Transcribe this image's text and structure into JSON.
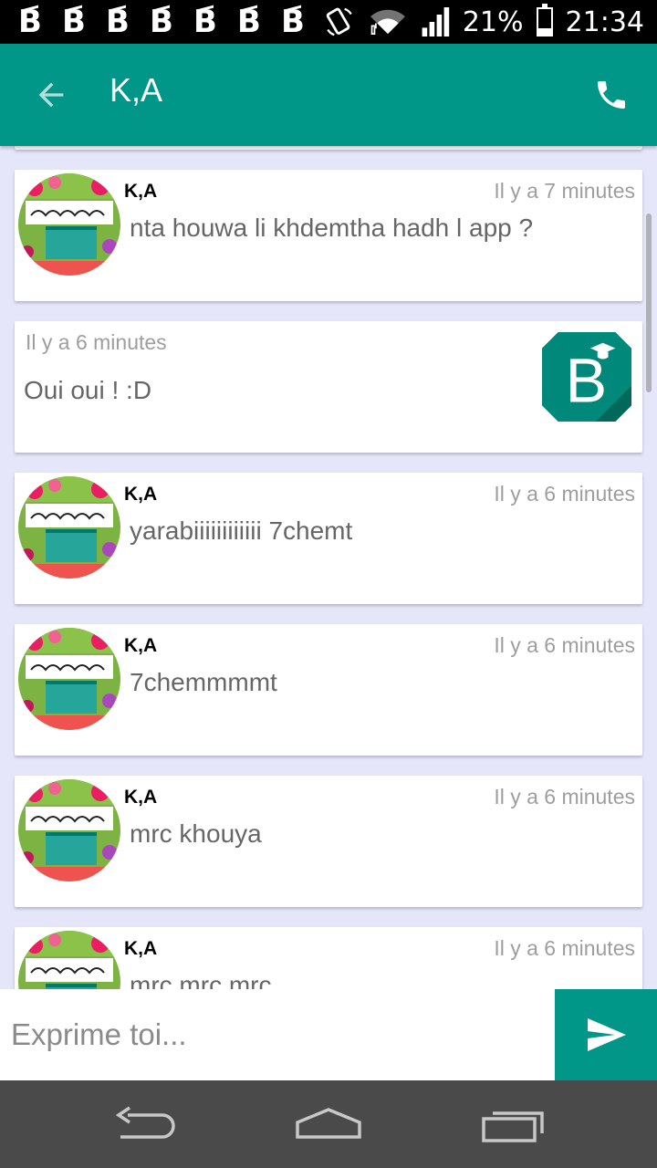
{
  "status_bar": {
    "notification_glyph": "B",
    "notification_count": 7,
    "battery": "21%",
    "time": "21:34"
  },
  "app_bar": {
    "title": "K,A"
  },
  "colors": {
    "primary": "#009688",
    "background": "#e6e6fa",
    "time_text": "#9e9e9e",
    "message_text": "#666666"
  },
  "messages": [
    {
      "sender": "K,A",
      "time": "Il y a 7 minutes",
      "text": "nta houwa li khdemtha hadh l app ?",
      "mine": false
    },
    {
      "sender": "",
      "time": "Il y a 6 minutes",
      "text": "Oui oui ! :D",
      "mine": true
    },
    {
      "sender": "K,A",
      "time": "Il y a 6 minutes",
      "text": "yarabiiiiiiiiiiii 7chemt",
      "mine": false
    },
    {
      "sender": "K,A",
      "time": "Il y a 6 minutes",
      "text": "7chemmmmt",
      "mine": false
    },
    {
      "sender": "K,A",
      "time": "Il y a 6 minutes",
      "text": "mrc khouya",
      "mine": false
    },
    {
      "sender": "K,A",
      "time": "Il y a 6 minutes",
      "text": "mrc mrc mrc",
      "mine": false
    }
  ],
  "composer": {
    "placeholder": "Exprime toi..."
  }
}
